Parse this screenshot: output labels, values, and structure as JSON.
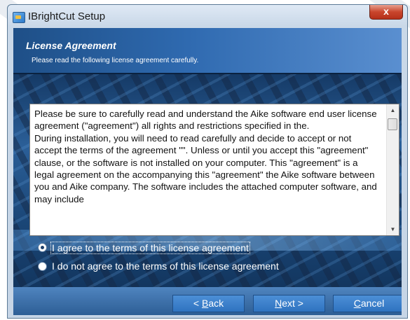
{
  "window": {
    "title": "IBrightCut Setup",
    "close_glyph": "x",
    "icons": {
      "app": "setup-app-icon",
      "close": "close-icon"
    }
  },
  "header": {
    "title": "License Agreement",
    "subtitle": "Please read the following license agreement carefully."
  },
  "license": {
    "text": "Please be sure to carefully read and understand the Aike software end user license agreement (\"agreement\") all rights and restrictions specified in the.\nDuring installation, you will need to read carefully and decide to accept or not accept the terms of the agreement \"\". Unless or until you accept this \"agreement\" clause, or the software is not installed on your computer. This \"agreement\" is a legal agreement on the accompanying this \"agreement\" the Aike software between you and Aike company. The software includes the attached computer software, and may include",
    "scroll_up_glyph": "▲",
    "scroll_down_glyph": "▼"
  },
  "options": [
    {
      "label": "I agree to the terms of this license agreement",
      "selected": true
    },
    {
      "label": "I do not agree to the terms of this license agreement",
      "selected": false
    }
  ],
  "buttons": {
    "back": {
      "label": "< Back",
      "prefix": "< ",
      "mnemonic": "B",
      "rest": "ack"
    },
    "next": {
      "label": "Next >",
      "mnemonic": "N",
      "rest": "ext >"
    },
    "cancel": {
      "label": "Cancel",
      "mnemonic": "C",
      "rest": "ancel"
    }
  },
  "colors": {
    "header_gradient": [
      "#1e4f87",
      "#5a8fd0"
    ],
    "button": "#3a7fcb",
    "close_button": "#c9452c"
  }
}
